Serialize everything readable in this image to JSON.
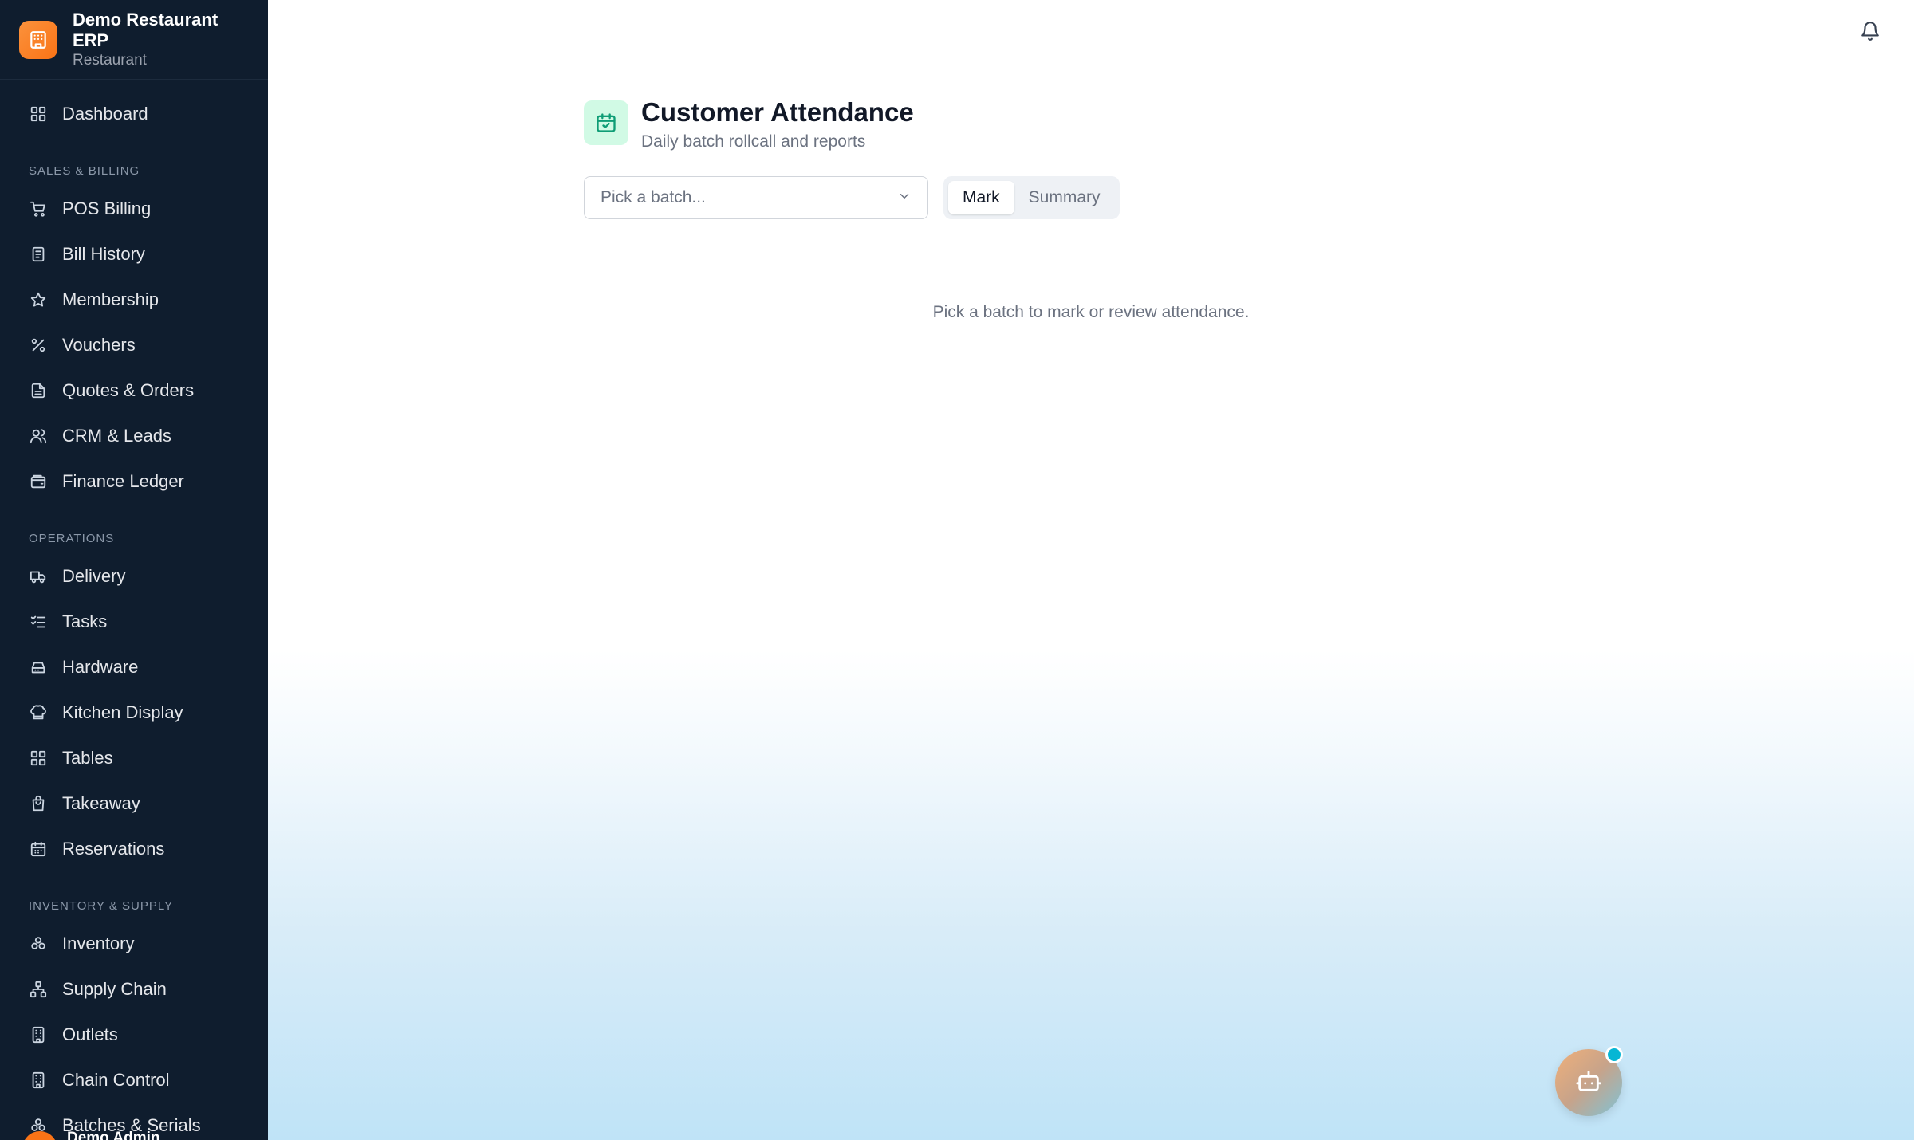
{
  "brand": {
    "title": "Demo Restaurant ERP",
    "subtitle": "Restaurant"
  },
  "sidebar": {
    "dashboard": {
      "label": "Dashboard",
      "icon": "grid-icon"
    },
    "sections": [
      {
        "title": "SALES & BILLING",
        "items": [
          {
            "label": "POS Billing",
            "icon": "cart-icon"
          },
          {
            "label": "Bill History",
            "icon": "receipt-icon"
          },
          {
            "label": "Membership",
            "icon": "star-icon"
          },
          {
            "label": "Vouchers",
            "icon": "percent-icon"
          },
          {
            "label": "Quotes & Orders",
            "icon": "document-icon"
          },
          {
            "label": "CRM & Leads",
            "icon": "users-icon"
          },
          {
            "label": "Finance Ledger",
            "icon": "wallet-icon"
          }
        ]
      },
      {
        "title": "OPERATIONS",
        "items": [
          {
            "label": "Delivery",
            "icon": "truck-icon"
          },
          {
            "label": "Tasks",
            "icon": "checklist-icon"
          },
          {
            "label": "Hardware",
            "icon": "hard-drive-icon"
          },
          {
            "label": "Kitchen Display",
            "icon": "chef-hat-icon"
          },
          {
            "label": "Tables",
            "icon": "grid-icon"
          },
          {
            "label": "Takeaway",
            "icon": "bag-icon"
          },
          {
            "label": "Reservations",
            "icon": "calendar-icon"
          }
        ]
      },
      {
        "title": "INVENTORY & SUPPLY",
        "items": [
          {
            "label": "Inventory",
            "icon": "boxes-icon"
          },
          {
            "label": "Supply Chain",
            "icon": "network-icon"
          },
          {
            "label": "Outlets",
            "icon": "building-icon"
          },
          {
            "label": "Chain Control",
            "icon": "building-icon"
          },
          {
            "label": "Batches & Serials",
            "icon": "boxes-icon"
          }
        ]
      }
    ],
    "user": {
      "name": "Demo Admin"
    }
  },
  "page": {
    "title": "Customer Attendance",
    "subtitle": "Daily batch rollcall and reports",
    "batch_select": {
      "placeholder": "Pick a batch..."
    },
    "tabs": [
      {
        "label": "Mark",
        "active": true
      },
      {
        "label": "Summary",
        "active": false
      }
    ],
    "empty_message": "Pick a batch to mark or review attendance."
  },
  "colors": {
    "sidebar_bg": "#0f1d2e",
    "brand_accent": "#f97316",
    "header_icon_bg": "#d1fae5",
    "header_icon": "#0f9d76",
    "notification_dot": "#06b6d4"
  }
}
